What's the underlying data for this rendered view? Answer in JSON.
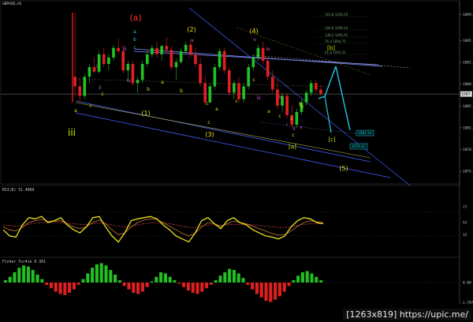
{
  "symbol_header": "GBPUSD,H1",
  "watermark": "[1263x819] https://upic.me/",
  "colors": {
    "background": "#000000",
    "bull": "#22c022",
    "bear": "#e02020",
    "lime": "#c8e800",
    "magenta": "#e060e0",
    "cyan": "#20c8e8",
    "yellow": "#e8e020",
    "blue": "#4060ff",
    "red_label": "#ff3030"
  },
  "chart_data": [
    {
      "type": "candlestick",
      "title": "GBPUSD,H1",
      "price_axis_ticks": [
        "1099.70",
        "1095.65",
        "1092.25",
        "1088.84",
        "1085.43",
        "1082.03",
        "1078.62",
        "1075.21"
      ],
      "current_price": "1087.3",
      "ylim": [
        1073.5,
        1101.5
      ],
      "candles": [
        [
          1090.0,
          1100.0,
          1087.0,
          1088.5
        ],
        [
          1088.5,
          1090.0,
          1086.0,
          1087.0
        ],
        [
          1087.0,
          1090.5,
          1086.5,
          1090.0
        ],
        [
          1090.0,
          1092.0,
          1089.0,
          1091.5
        ],
        [
          1091.5,
          1093.0,
          1090.5,
          1090.8
        ],
        [
          1090.8,
          1094.0,
          1090.5,
          1093.5
        ],
        [
          1093.5,
          1094.5,
          1091.5,
          1092.0
        ],
        [
          1092.0,
          1093.5,
          1091.0,
          1093.0
        ],
        [
          1093.0,
          1095.0,
          1092.5,
          1094.5
        ],
        [
          1094.5,
          1096.0,
          1093.5,
          1094.0
        ],
        [
          1094.0,
          1095.0,
          1090.5,
          1091.0
        ],
        [
          1091.0,
          1092.5,
          1089.5,
          1092.0
        ],
        [
          1092.0,
          1092.5,
          1088.5,
          1089.0
        ],
        [
          1089.0,
          1090.0,
          1087.5,
          1089.5
        ],
        [
          1089.5,
          1092.5,
          1089.0,
          1092.0
        ],
        [
          1092.0,
          1094.0,
          1091.5,
          1093.5
        ],
        [
          1093.5,
          1095.0,
          1093.0,
          1094.5
        ],
        [
          1094.5,
          1095.5,
          1093.0,
          1093.5
        ],
        [
          1093.5,
          1095.0,
          1092.5,
          1094.8
        ],
        [
          1094.8,
          1096.2,
          1093.8,
          1094.2
        ],
        [
          1094.2,
          1094.8,
          1091.0,
          1091.5
        ],
        [
          1091.5,
          1092.8,
          1089.5,
          1092.3
        ],
        [
          1092.3,
          1094.5,
          1092.0,
          1094.0
        ],
        [
          1094.0,
          1095.5,
          1093.5,
          1095.0
        ],
        [
          1095.0,
          1095.8,
          1093.0,
          1093.5
        ],
        [
          1093.5,
          1094.5,
          1091.5,
          1092.0
        ],
        [
          1092.0,
          1093.0,
          1088.5,
          1089.0
        ],
        [
          1089.0,
          1090.0,
          1085.5,
          1086.0
        ],
        [
          1086.0,
          1089.0,
          1085.8,
          1088.5
        ],
        [
          1088.5,
          1092.0,
          1088.0,
          1091.5
        ],
        [
          1091.5,
          1094.5,
          1091.0,
          1094.0
        ],
        [
          1094.0,
          1094.5,
          1090.5,
          1091.0
        ],
        [
          1091.0,
          1091.5,
          1087.0,
          1087.5
        ],
        [
          1087.5,
          1089.5,
          1086.5,
          1089.0
        ],
        [
          1089.0,
          1090.0,
          1086.0,
          1086.5
        ],
        [
          1086.5,
          1089.0,
          1086.0,
          1088.5
        ],
        [
          1088.5,
          1092.0,
          1088.0,
          1091.5
        ],
        [
          1091.5,
          1093.5,
          1091.0,
          1093.0
        ],
        [
          1093.0,
          1095.0,
          1092.5,
          1094.5
        ],
        [
          1094.5,
          1095.5,
          1092.0,
          1092.5
        ],
        [
          1092.5,
          1093.0,
          1089.5,
          1090.0
        ],
        [
          1090.0,
          1091.0,
          1087.5,
          1088.0
        ],
        [
          1088.0,
          1089.5,
          1085.0,
          1085.5
        ],
        [
          1085.5,
          1087.5,
          1084.5,
          1087.0
        ],
        [
          1087.0,
          1087.5,
          1083.5,
          1084.0
        ],
        [
          1084.0,
          1085.5,
          1082.0,
          1082.5
        ],
        [
          1082.5,
          1085.0,
          1082.0,
          1084.5
        ],
        [
          1084.5,
          1086.5,
          1084.0,
          1086.0
        ],
        [
          1086.0,
          1088.0,
          1085.5,
          1087.5
        ],
        [
          1087.5,
          1089.5,
          1087.0,
          1089.0
        ],
        [
          1089.0,
          1089.5,
          1087.5,
          1088.0
        ],
        [
          1088.0,
          1088.8,
          1087.0,
          1087.3
        ]
      ],
      "wave_labels": [
        {
          "text": "(a)",
          "color": "red_label",
          "size": "large"
        },
        {
          "text": "(2)",
          "color": "yellow"
        },
        {
          "text": "(4)",
          "color": "yellow"
        },
        {
          "text": "(1)",
          "color": "yellow"
        },
        {
          "text": "(3)",
          "color": "yellow"
        },
        {
          "text": "(5)",
          "color": "yellow"
        },
        {
          "text": "[b]",
          "color": "lime"
        },
        {
          "text": "[a]",
          "color": "lime"
        },
        {
          "text": "[c]",
          "color": "lime"
        },
        {
          "text": "iii",
          "color": "lime",
          "size": "large"
        },
        {
          "text": "a",
          "color": "cyan"
        },
        {
          "text": "b",
          "color": "cyan"
        },
        {
          "text": "c",
          "color": "cyan"
        },
        {
          "text": "v",
          "color": "magenta"
        },
        {
          "text": "iii",
          "color": "magenta"
        },
        {
          "text": "iv",
          "color": "magenta"
        },
        {
          "text": "ii",
          "color": "magenta"
        },
        {
          "text": "i",
          "color": "magenta"
        },
        {
          "text": "v",
          "color": "magenta"
        },
        {
          "text": "iv",
          "color": "magenta"
        },
        {
          "text": "b",
          "color": "lime"
        },
        {
          "text": "a",
          "color": "lime"
        },
        {
          "text": "c",
          "color": "lime"
        },
        {
          "text": "c",
          "color": "lime"
        },
        {
          "text": "a",
          "color": "lime"
        },
        {
          "text": "b",
          "color": "lime"
        },
        {
          "text": "c",
          "color": "lime"
        },
        {
          "text": "a",
          "color": "lime"
        },
        {
          "text": "c",
          "color": "lime"
        },
        {
          "text": "c",
          "color": "yellow"
        },
        {
          "text": "c",
          "color": "yellow"
        },
        {
          "text": "c",
          "color": "lime"
        },
        {
          "text": "c",
          "color": "yellow"
        },
        {
          "text": "b",
          "color": "lime"
        },
        {
          "text": "iii",
          "color": "magenta"
        },
        {
          "text": "iv",
          "color": "magenta"
        },
        {
          "text": "i",
          "color": "magenta"
        },
        {
          "text": "ii",
          "color": "magenta"
        },
        {
          "text": "v",
          "color": "magenta"
        },
        {
          "text": "a",
          "color": "lime"
        },
        {
          "text": "b",
          "color": "lime"
        },
        {
          "text": "c",
          "color": "lime"
        }
      ],
      "fib_labels": [
        "161.8 1100.29",
        "100.0 1096.54",
        "138.2 1095.91",
        "76.4 1094.75",
        "61.8 1092.51"
      ],
      "target_boxes": [
        "1081.14",
        "1079.42"
      ]
    },
    {
      "type": "line",
      "title": "RSI(8) 51.4069",
      "ylim": [
        0,
        100
      ],
      "price_axis_ticks": [
        "77",
        "52",
        "32"
      ],
      "series": [
        {
          "name": "RSI(8)",
          "color": "yellow",
          "values": [
            40,
            30,
            28,
            48,
            60,
            58,
            62,
            52,
            55,
            60,
            48,
            40,
            35,
            45,
            60,
            62,
            45,
            30,
            20,
            35,
            55,
            58,
            60,
            62,
            58,
            48,
            40,
            30,
            25,
            20,
            35,
            55,
            60,
            50,
            42,
            55,
            60,
            52,
            48,
            40,
            35,
            30,
            28,
            25,
            30,
            45,
            55,
            60,
            58,
            52,
            50
          ]
        },
        {
          "name": "",
          "color": "#c87830",
          "values": [
            45,
            40,
            38,
            44,
            52,
            55,
            57,
            54,
            54,
            55,
            50,
            45,
            42,
            45,
            52,
            56,
            50,
            40,
            32,
            35,
            45,
            52,
            56,
            58,
            57,
            52,
            46,
            40,
            34,
            30,
            34,
            45,
            52,
            50,
            46,
            50,
            54,
            52,
            50,
            46,
            42,
            38,
            34,
            31,
            32,
            38,
            46,
            52,
            55,
            53,
            52
          ]
        },
        {
          "name": "",
          "color": "#d04040",
          "dashed": true,
          "values": [
            48,
            47,
            46,
            47,
            49,
            51,
            52,
            52,
            52,
            52,
            51,
            50,
            49,
            49,
            50,
            51,
            50,
            48,
            46,
            45,
            46,
            48,
            50,
            51,
            52,
            51,
            50,
            48,
            46,
            44,
            44,
            46,
            48,
            48,
            47,
            48,
            49,
            49,
            49,
            48,
            47,
            46,
            45,
            44,
            44,
            45,
            47,
            49,
            50,
            50,
            50
          ]
        }
      ]
    },
    {
      "type": "bar",
      "title": "Fisher_Yur4ik 0.301",
      "ylim": [
        -1.8,
        1.8
      ],
      "price_axis_ticks": [
        "0.00",
        "-1.797"
      ],
      "values": [
        0.2,
        0.5,
        0.9,
        1.3,
        1.5,
        1.4,
        1.1,
        0.7,
        0.3,
        -0.2,
        -0.5,
        -0.8,
        -1.0,
        -1.1,
        -0.9,
        -0.6,
        -0.2,
        0.3,
        0.8,
        1.3,
        1.6,
        1.7,
        1.5,
        1.1,
        0.7,
        0.2,
        -0.3,
        -0.6,
        -0.9,
        -1.0,
        -0.8,
        -0.4,
        0.1,
        0.5,
        0.9,
        0.8,
        0.5,
        0.2,
        -0.1,
        -0.4,
        -0.7,
        -0.9,
        -1.0,
        -0.8,
        -0.5,
        -0.2,
        0.2,
        0.6,
        0.9,
        1.2,
        1.1,
        0.8,
        0.4,
        -0.2,
        -0.6,
        -1.0,
        -1.3,
        -1.6,
        -1.7,
        -1.5,
        -1.2,
        -0.8,
        -0.3,
        0.2,
        0.6,
        0.9,
        1.0,
        0.8,
        0.5,
        0.2
      ]
    }
  ]
}
